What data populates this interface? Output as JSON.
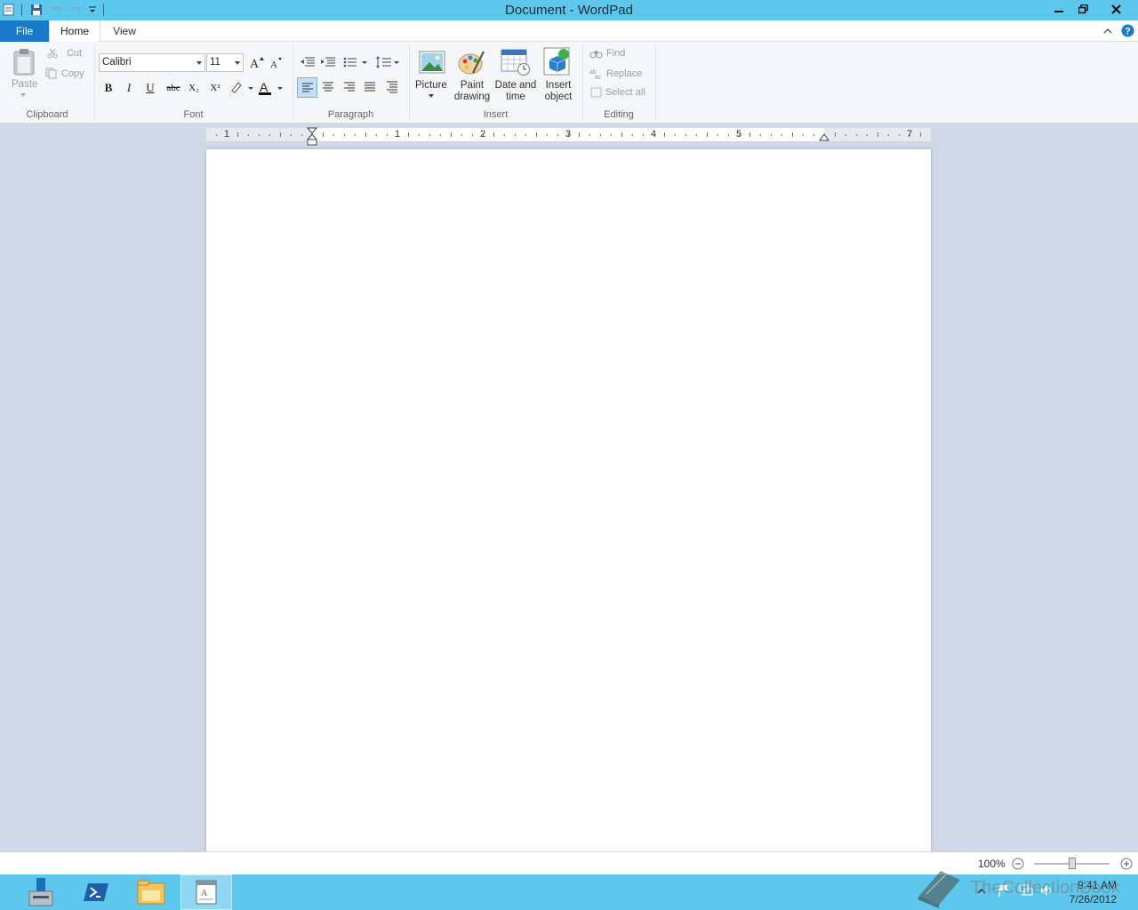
{
  "window": {
    "title": "Document - WordPad"
  },
  "tabs": {
    "file": "File",
    "home": "Home",
    "view": "View"
  },
  "clipboard": {
    "paste": "Paste",
    "cut": "Cut",
    "copy": "Copy",
    "label": "Clipboard"
  },
  "font": {
    "family": "Calibri",
    "size": "11",
    "label": "Font",
    "bold": "B",
    "italic": "I",
    "underline": "U",
    "strike": "abc",
    "subscript": "X₂",
    "superscript": "X²",
    "color_glyph": "A"
  },
  "paragraph": {
    "label": "Paragraph"
  },
  "insert": {
    "picture": "Picture",
    "paint_line1": "Paint",
    "paint_line2": "drawing",
    "datetime_line1": "Date and",
    "datetime_line2": "time",
    "object_line1": "Insert",
    "object_line2": "object",
    "label": "Insert"
  },
  "editing": {
    "find": "Find",
    "replace": "Replace",
    "select_all": "Select all",
    "label": "Editing"
  },
  "ruler": {
    "numbers": [
      "1",
      "1",
      "2",
      "3",
      "4",
      "5",
      "7"
    ]
  },
  "status": {
    "zoom": "100%"
  },
  "taskbar": {
    "time": "9:41 AM",
    "date": "7/26/2012"
  },
  "watermark": {
    "text": "TheCollectionBook"
  },
  "colors": {
    "titlebar": "#5ec8ec",
    "file_tab": "#1979ca",
    "highlight": "#fff"
  }
}
